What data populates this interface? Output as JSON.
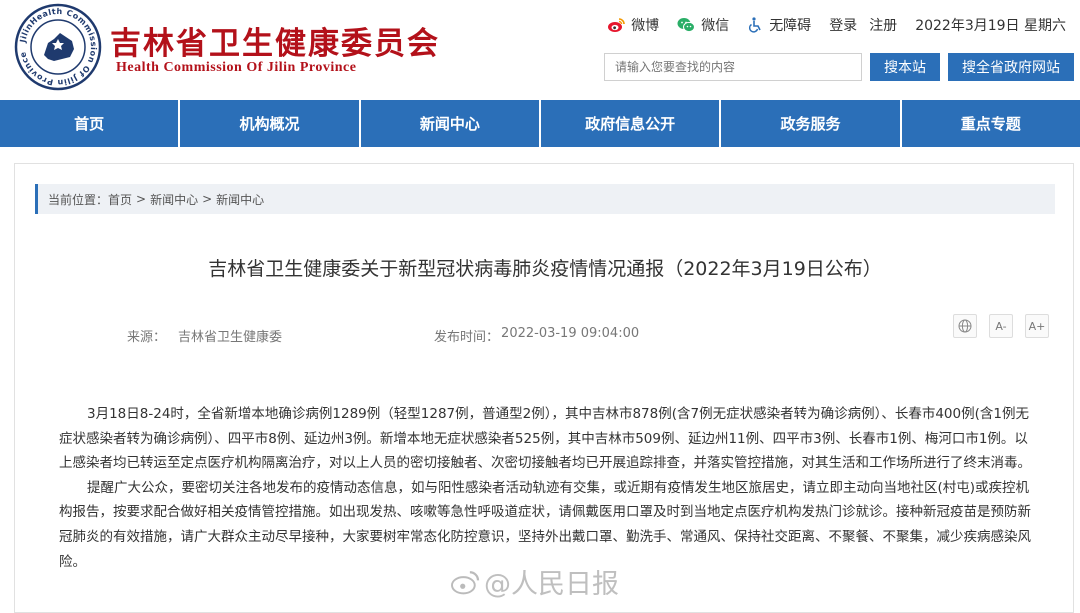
{
  "site": {
    "title": "吉林省卫生健康委员会",
    "subtitle": "Health Commission Of Jilin Province",
    "seal_text": "JilinHealth Commission Of Jilin Province"
  },
  "topbar": {
    "weibo": "微博",
    "weixin": "微信",
    "accessibility": "无障碍",
    "login": "登录",
    "register": "注册",
    "date": "2022年3月19日 星期六"
  },
  "search": {
    "placeholder": "请输入您要查找的内容",
    "site_button": "搜本站",
    "province_button": "搜全省政府网站"
  },
  "nav": [
    {
      "label": "首页"
    },
    {
      "label": "机构概况"
    },
    {
      "label": "新闻中心"
    },
    {
      "label": "政府信息公开"
    },
    {
      "label": "政务服务"
    },
    {
      "label": "重点专题"
    }
  ],
  "breadcrumb": {
    "prefix": "当前位置：",
    "items": [
      "首页",
      "新闻中心",
      "新闻中心"
    ],
    "separator": ">"
  },
  "article": {
    "title": "吉林省卫生健康委关于新型冠状病毒肺炎疫情情况通报（2022年3月19日公布）",
    "source_label": "来源：",
    "source": "吉林省卫生健康委",
    "time_label": "发布时间：",
    "time": "2022-03-19 09:04:00",
    "font_small": "A-",
    "font_large": "A+",
    "paragraphs": [
      "3月18日8-24时，全省新增本地确诊病例1289例（轻型1287例，普通型2例），其中吉林市878例(含7例无症状感染者转为确诊病例）、长春市400例(含1例无症状感染者转为确诊病例）、四平市8例、延边州3例。新增本地无症状感染者525例，其中吉林市509例、延边州11例、四平市3例、长春市1例、梅河口市1例。以上感染者均已转运至定点医疗机构隔离治疗，对以上人员的密切接触者、次密切接触者均已开展追踪排查，并落实管控措施，对其生活和工作场所进行了终末消毒。",
      "提醒广大公众，要密切关注各地发布的疫情动态信息，如与阳性感染者活动轨迹有交集，或近期有疫情发生地区旅居史，请立即主动向当地社区(村屯)或疾控机构报告，按要求配合做好相关疫情管控措施。如出现发热、咳嗽等急性呼吸道症状，请佩戴医用口罩及时到当地定点医疗机构发热门诊就诊。接种新冠疫苗是预防新冠肺炎的有效措施，请广大群众主动尽早接种，大家要树牢常态化防控意识，坚持外出戴口罩、勤洗手、常通风、保持社交距离、不聚餐、不聚集，减少疾病感染风险。"
    ]
  },
  "watermark": "@人民日报",
  "colors": {
    "brand_red": "#b3111a",
    "nav_blue": "#2b6fb8"
  }
}
